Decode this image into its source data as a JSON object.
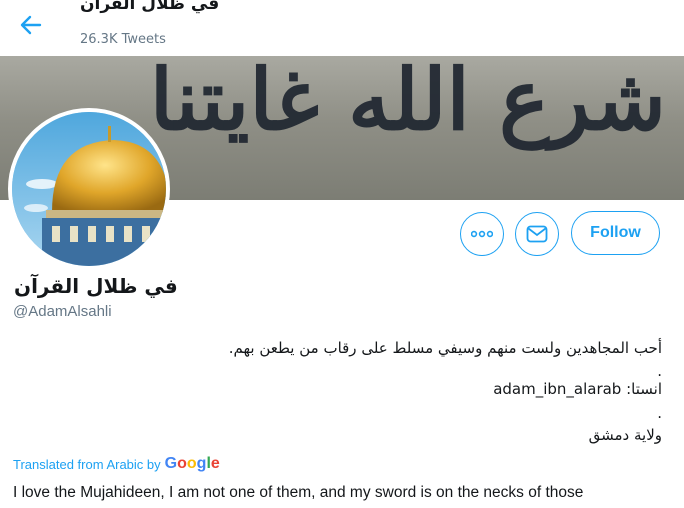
{
  "header": {
    "title": "في ظلال القرآن",
    "tweets_count": "26.3K Tweets"
  },
  "banner": {
    "text": "شرع الله غايتنا"
  },
  "actions": {
    "more_icon": "ellipsis-icon",
    "message_icon": "envelope-icon",
    "follow_label": "Follow"
  },
  "profile": {
    "name": "في ظلال القرآن",
    "handle": "@AdamAlsahli",
    "bio_line1": "أحب المجاهدين ولست منهم وسيفي مسلط على رقاب من يطعن بهم.",
    "bio_dot1": ".",
    "bio_line2": "انستا: adam_ibn_alarab",
    "bio_dot2": ".",
    "bio_line3": "ولاية دمشق"
  },
  "translation": {
    "label": "Translated from Arabic by",
    "google": [
      "G",
      "o",
      "o",
      "g",
      "l",
      "e"
    ],
    "text": "I love the Mujahideen, I am not one of them, and my sword is on the necks of those"
  },
  "colors": {
    "accent": "#1da1f2",
    "secondary_text": "#657786"
  }
}
